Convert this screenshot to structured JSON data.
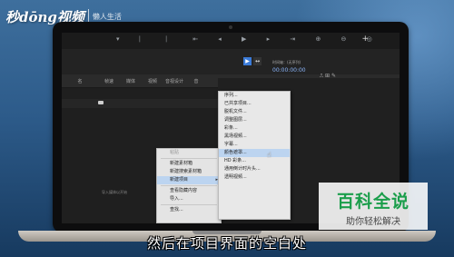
{
  "branding": {
    "logo_text": "秒dōng视频",
    "logo_sub": "懒人生活",
    "watermark_title": "百科全说",
    "watermark_sub": "助你轻松解决"
  },
  "caption": "然后在项目界面的空白处",
  "app": {
    "panel_tabs": [
      "名",
      "帧速",
      "媒体",
      "视频",
      "音视设计",
      "音"
    ],
    "sequence_title": "时间轴：(无序列)",
    "timecode": "00:00:00:00",
    "drop_hint": "导入媒体以开始"
  },
  "context_menu": {
    "items": [
      {
        "label": "粘贴",
        "disabled": true
      },
      {
        "label": "新建素材箱",
        "disabled": false
      },
      {
        "label": "新建搜索素材箱",
        "disabled": false
      },
      {
        "label": "新建项目",
        "disabled": false,
        "submenu": true,
        "highlighted": true
      },
      {
        "label": "查看隐藏内容",
        "disabled": false
      },
      {
        "label": "导入...",
        "disabled": false
      },
      {
        "label": "查找...",
        "disabled": false
      }
    ]
  },
  "submenu": {
    "items": [
      {
        "label": "序列...",
        "highlighted": false
      },
      {
        "label": "已共享项目...",
        "highlighted": false
      },
      {
        "label": "脱机文件...",
        "highlighted": false
      },
      {
        "label": "调整图层...",
        "highlighted": false
      },
      {
        "label": "彩条...",
        "highlighted": false
      },
      {
        "label": "黑场视频...",
        "highlighted": false
      },
      {
        "label": "字幕...",
        "highlighted": false
      },
      {
        "label": "颜色遮罩...",
        "highlighted": true
      },
      {
        "label": "HD 彩条...",
        "highlighted": false
      },
      {
        "label": "通用倒计时片头...",
        "highlighted": false
      },
      {
        "label": "透明视频...",
        "highlighted": false
      }
    ]
  },
  "colors": {
    "accent": "#3b7bd8",
    "menu_highlight": "#bcd4f0",
    "watermark_green": "#1b9e4b"
  }
}
